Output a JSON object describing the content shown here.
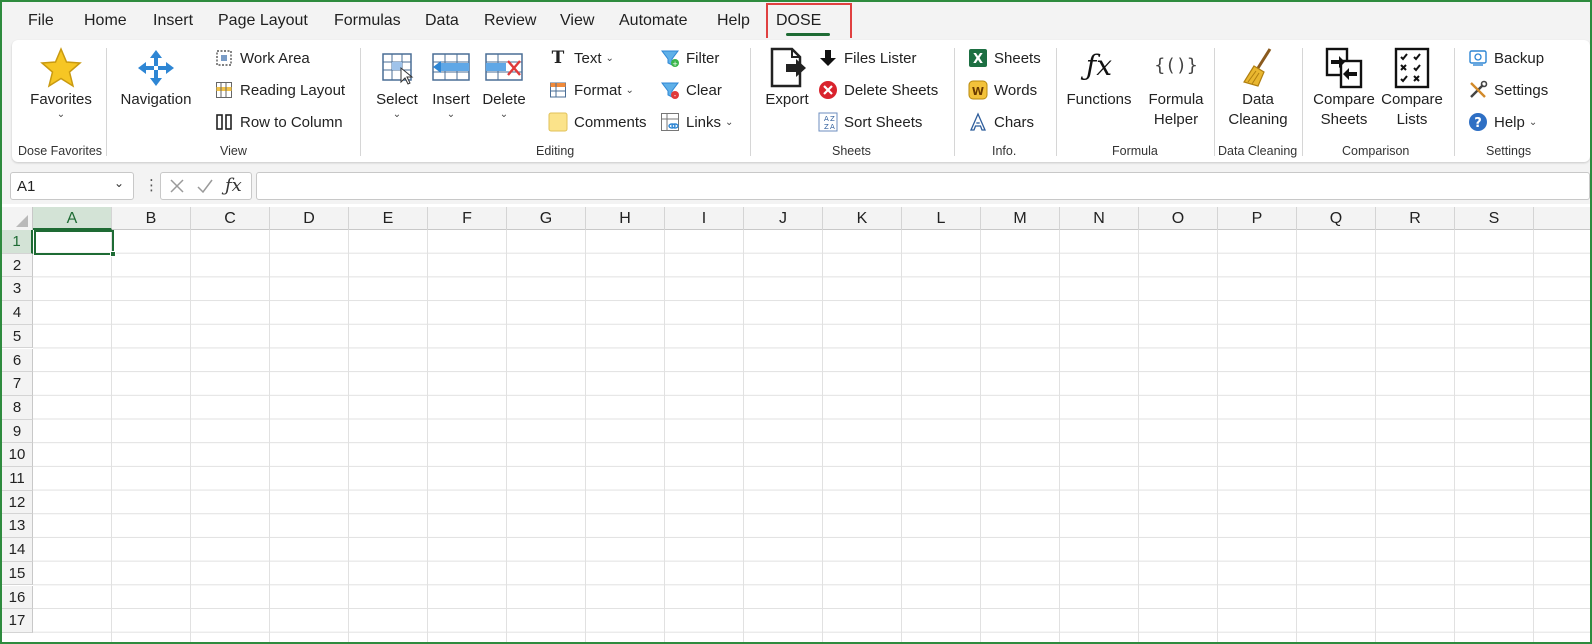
{
  "menu": {
    "tabs": [
      "File",
      "Home",
      "Insert",
      "Page Layout",
      "Formulas",
      "Data",
      "Review",
      "View",
      "Automate",
      "Help",
      "DOSE"
    ],
    "active": "DOSE"
  },
  "ribbon": {
    "favorites": {
      "label": "Favorites",
      "group": "Dose Favorites"
    },
    "view": {
      "navigation": "Navigation",
      "work_area": "Work Area",
      "reading_layout": "Reading Layout",
      "row_to_column": "Row to Column",
      "group": "View"
    },
    "editing": {
      "select": "Select",
      "insert": "Insert",
      "delete": "Delete",
      "text": "Text",
      "format": "Format",
      "comments": "Comments",
      "filter": "Filter",
      "clear": "Clear",
      "links": "Links",
      "group": "Editing"
    },
    "sheets": {
      "export": "Export",
      "files_lister": "Files Lister",
      "delete_sheets": "Delete Sheets",
      "sort_sheets": "Sort Sheets",
      "group": "Sheets"
    },
    "info": {
      "sheets": "Sheets",
      "words": "Words",
      "chars": "Chars",
      "group": "Info."
    },
    "formula": {
      "functions": "Functions",
      "formula_helper_1": "Formula",
      "formula_helper_2": "Helper",
      "group": "Formula"
    },
    "data_cleaning": {
      "label_1": "Data",
      "label_2": "Cleaning",
      "group": "Data Cleaning"
    },
    "comparison": {
      "compare_sheets_1": "Compare",
      "compare_sheets_2": "Sheets",
      "compare_lists_1": "Compare",
      "compare_lists_2": "Lists",
      "group": "Comparison"
    },
    "settings": {
      "backup": "Backup",
      "settings": "Settings",
      "help": "Help",
      "group": "Settings"
    }
  },
  "formula_bar": {
    "name_box": "A1",
    "formula": ""
  },
  "grid": {
    "columns": [
      "A",
      "B",
      "C",
      "D",
      "E",
      "F",
      "G",
      "H",
      "I",
      "J",
      "K",
      "L",
      "M",
      "N",
      "O",
      "P",
      "Q",
      "R",
      "S"
    ],
    "rows": [
      "1",
      "2",
      "3",
      "4",
      "5",
      "6",
      "7",
      "8",
      "9",
      "10",
      "11",
      "12",
      "13",
      "14",
      "15",
      "16",
      "17"
    ],
    "selected_cell": "A1"
  },
  "colors": {
    "accent_green": "#1e6b34",
    "highlight_red": "#e04040",
    "excel_green": "#1d6f42"
  }
}
